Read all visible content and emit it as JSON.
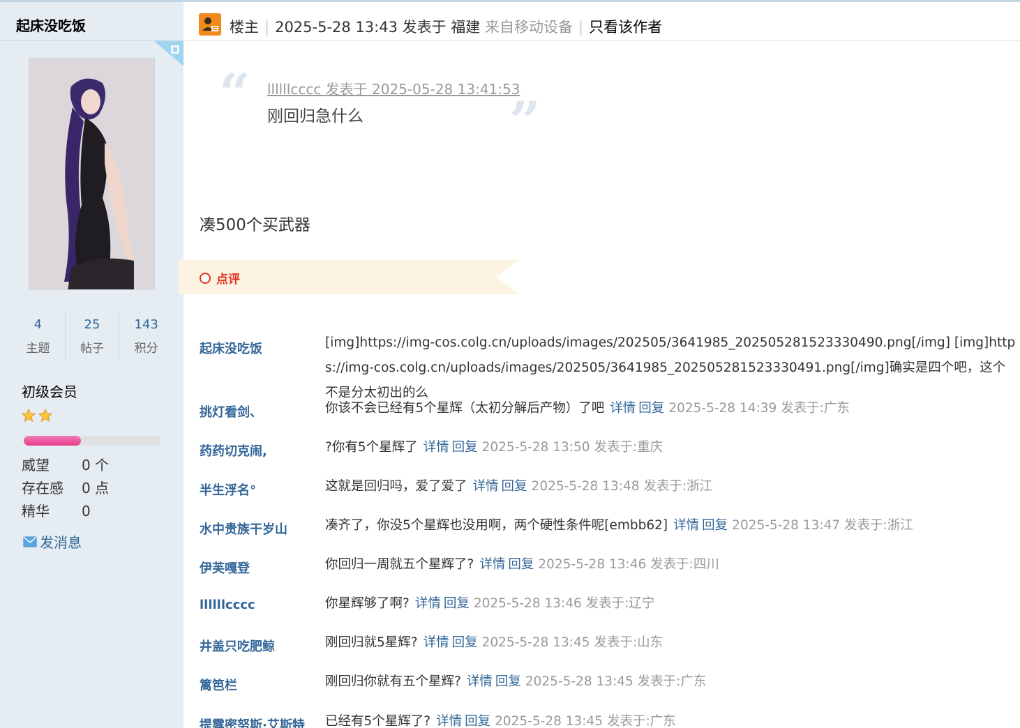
{
  "sidebar": {
    "username": "起床没吃饭",
    "stats": [
      {
        "num": "4",
        "label": "主题"
      },
      {
        "num": "25",
        "label": "帖子"
      },
      {
        "num": "143",
        "label": "积分"
      }
    ],
    "group": "初级会员",
    "stars": 2,
    "level_progress": 0.42,
    "info": [
      {
        "key": "威望",
        "value": "0 个"
      },
      {
        "key": "存在感",
        "value": "0 点"
      },
      {
        "key": "精华",
        "value": "0"
      }
    ],
    "send_message": "发消息"
  },
  "post_header": {
    "role": "楼主",
    "posted_time": "2025-5-28 13:43 发表于 福建",
    "device": "来自移动设备",
    "author_only": "只看该作者"
  },
  "quote": {
    "meta": "llllllcccc 发表于 2025-05-28 13:41:53",
    "body": "刚回归急什么"
  },
  "post_body": "凑500个买武器",
  "rate": {
    "label": "点评"
  },
  "comments": [
    {
      "user": "起床没吃饭",
      "text": "[img]https://img-cos.colg.cn/uploads/images/202505/3641985_20250528152333049​0.png[/img] [img]https://img-cos.colg.cn/uploads/images/202505/3641985_20250528152333049​1.png[/img]确实是四个吧，这个不是分太初出的么"
    },
    {
      "user": "挑灯看剑、",
      "text": "你该不会已经有5个星辉（太初分解后产物）了吧",
      "detail": "详情",
      "reply": "回复",
      "time": "2025-5-28 14:39 发表于:广东"
    },
    {
      "user": "药药切克闹,",
      "text": "?你有5个星辉了",
      "detail": "详情",
      "reply": "回复",
      "time": "2025-5-28 13:50 发表于:重庆"
    },
    {
      "user": "半生浮名°",
      "text": "这就是回归吗，爱了爱了",
      "detail": "详情",
      "reply": "回复",
      "time": "2025-5-28 13:48 发表于:浙江"
    },
    {
      "user": "水中贵族干岁山",
      "text": "凑齐了，你没5个星辉也没用啊，两个硬性条件呢[embb62]",
      "detail": "详情",
      "reply": "回复",
      "time": "2025-5-28 13:47 发表于:浙江"
    },
    {
      "user": "伊芙嘎登",
      "text": "你回归一周就五个星辉了?",
      "detail": "详情",
      "reply": "回复",
      "time": "2025-5-28 13:46 发表于:四川"
    },
    {
      "user": "llllllcccc",
      "text": "你星辉够了啊?",
      "detail": "详情",
      "reply": "回复",
      "time": "2025-5-28 13:46 发表于:辽宁"
    },
    {
      "user": "井盖只吃肥鲸",
      "text": "刚回归就5星辉?",
      "detail": "详情",
      "reply": "回复",
      "time": "2025-5-28 13:45 发表于:山东"
    },
    {
      "user": "篱笆栏",
      "text": "刚回归你就有五个星辉?",
      "detail": "详情",
      "reply": "回复",
      "time": "2025-5-28 13:45 发表于:广东"
    },
    {
      "user": "提露密努斯·艾斯特",
      "text": "已经有5个星辉了?",
      "detail": "详情",
      "reply": "回复",
      "time": "2025-5-28 13:45 发表于:广东"
    }
  ],
  "colors": {
    "sidebar_bg": "#e5edf2",
    "link": "#369",
    "accent_red": "#e0301e",
    "banner": "#fdf3e1"
  }
}
